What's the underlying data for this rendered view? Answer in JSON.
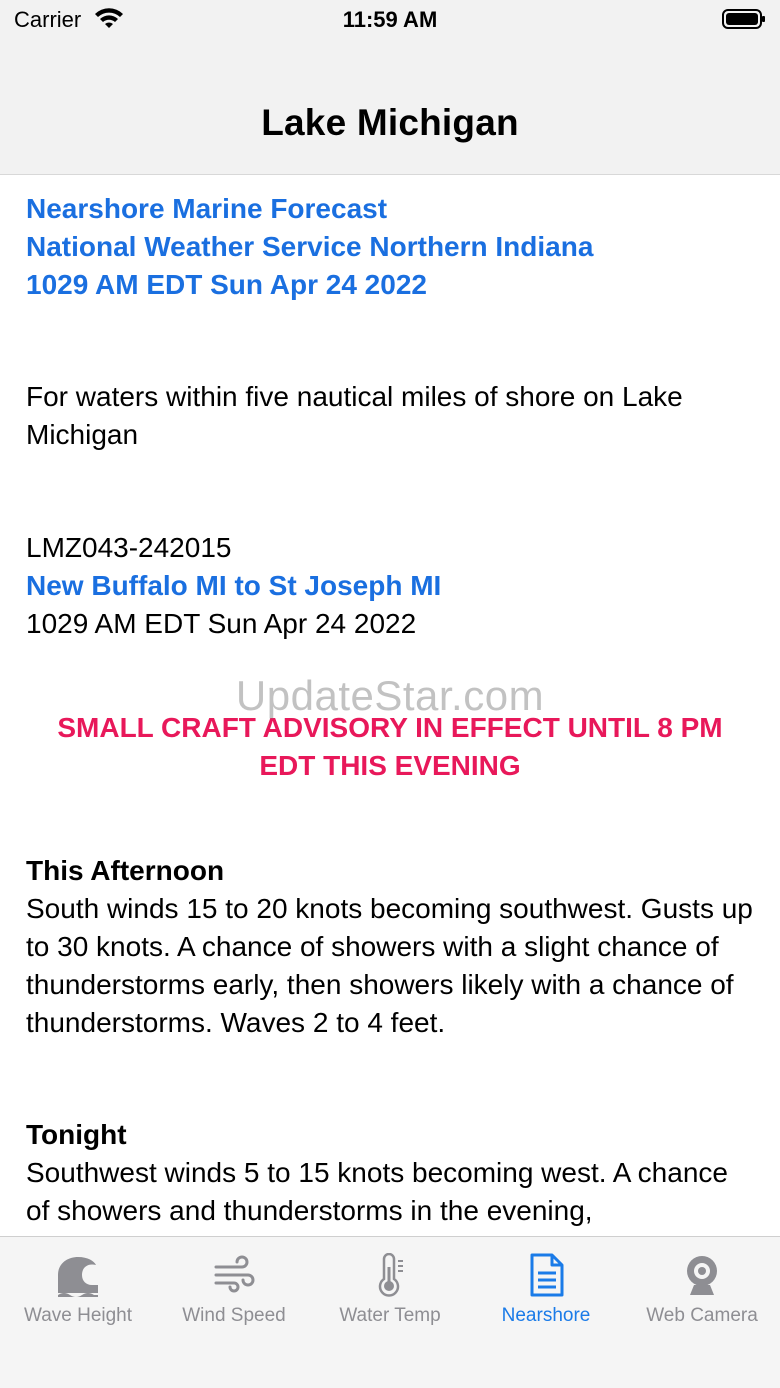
{
  "status": {
    "carrier": "Carrier",
    "time": "11:59 AM"
  },
  "nav": {
    "title": "Lake Michigan"
  },
  "forecast": {
    "header_line1": "Nearshore Marine Forecast",
    "header_line2": "National Weather Service Northern Indiana",
    "header_line3": "1029 AM EDT Sun Apr 24 2022",
    "intro": "For waters within five nautical miles of shore on Lake Michigan",
    "zone_code": "LMZ043-242015",
    "zone_name": "New Buffalo MI to St Joseph MI",
    "zone_time": "1029 AM EDT Sun Apr 24 2022",
    "advisory": "SMALL CRAFT ADVISORY IN EFFECT UNTIL 8 PM EDT THIS EVENING",
    "periods": [
      {
        "name": "This Afternoon",
        "text_line1": "South winds 15 to 20 knots becoming southwest. Gusts up to 30 knots. A chance of showers with a slight chance of thunderstorms early, then showers likely with a chance of",
        "text_line2": "thunderstorms. Waves 2 to 4 feet."
      },
      {
        "name": "Tonight",
        "text_line1": "Southwest winds 5 to 15 knots becoming west. A chance of showers and thunderstorms in the evening,"
      }
    ]
  },
  "watermark": "UpdateStar.com",
  "tabs": [
    {
      "label": "Wave Height",
      "icon": "wave-icon"
    },
    {
      "label": "Wind Speed",
      "icon": "wind-icon"
    },
    {
      "label": "Water Temp",
      "icon": "thermometer-icon"
    },
    {
      "label": "Nearshore",
      "icon": "document-icon"
    },
    {
      "label": "Web Camera",
      "icon": "webcam-icon"
    }
  ],
  "colors": {
    "accent": "#1a7be8",
    "link_blue": "#1a6fe0",
    "advisory_red": "#e8185a",
    "tab_inactive": "#8e8e93"
  }
}
